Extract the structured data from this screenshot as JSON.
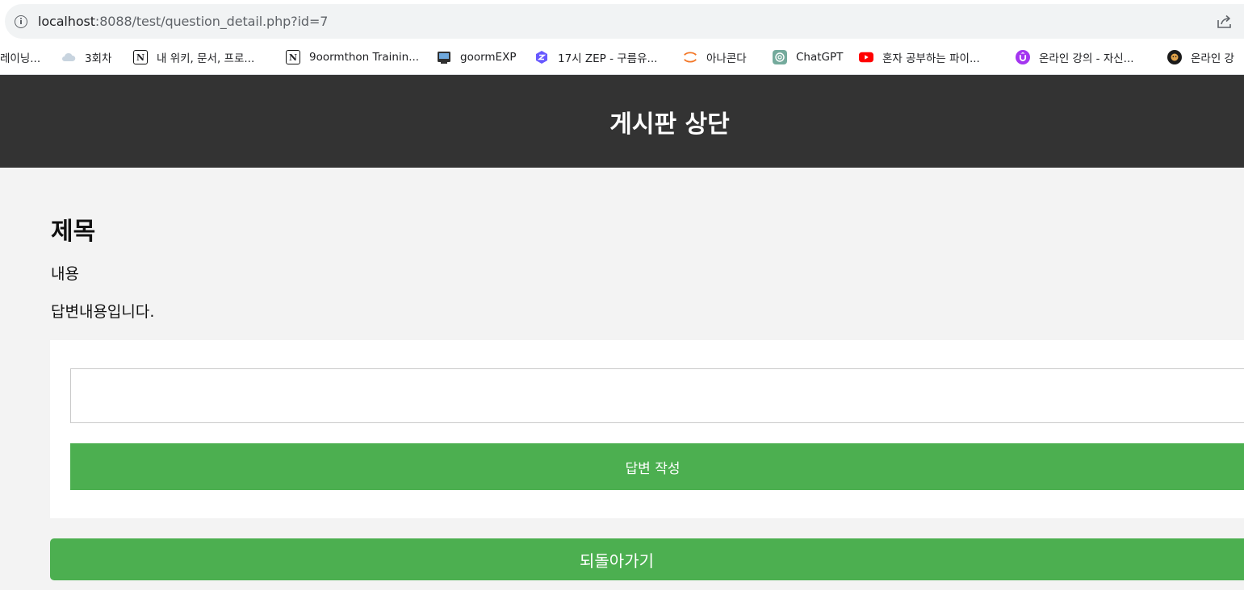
{
  "browser": {
    "url_host": "localhost",
    "url_path": ":8088/test/question_detail.php?id=7",
    "bookmarks": [
      {
        "label": "레이닝...",
        "icon": "none"
      },
      {
        "label": "3회차",
        "icon": "cloud-icon"
      },
      {
        "label": "내 위키, 문서, 프로...",
        "icon": "notion-icon"
      },
      {
        "label": "9oormthon Trainin...",
        "icon": "notion-icon"
      },
      {
        "label": "goormEXP",
        "icon": "goormexp-icon"
      },
      {
        "label": "17시 ZEP - 구름유...",
        "icon": "zep-icon"
      },
      {
        "label": "아나콘다",
        "icon": "jupyter-icon"
      },
      {
        "label": "ChatGPT",
        "icon": "chatgpt-icon"
      },
      {
        "label": "혼자 공부하는 파이...",
        "icon": "youtube-icon"
      },
      {
        "label": "온라인 강의 - 자신...",
        "icon": "udemy-icon"
      },
      {
        "label": "온라인 강",
        "icon": "lion-icon"
      }
    ]
  },
  "header": {
    "title": "게시판 상단"
  },
  "question": {
    "title": "제목",
    "content": "내용"
  },
  "answers": [
    {
      "content": "답변내용입니다."
    }
  ],
  "answer_form": {
    "input_value": "",
    "submit_label": "답변 작성"
  },
  "back_label": "되돌아가기",
  "colors": {
    "header_bg": "#333333",
    "button_green": "#4caf50",
    "page_bg": "#f3f3f3"
  }
}
